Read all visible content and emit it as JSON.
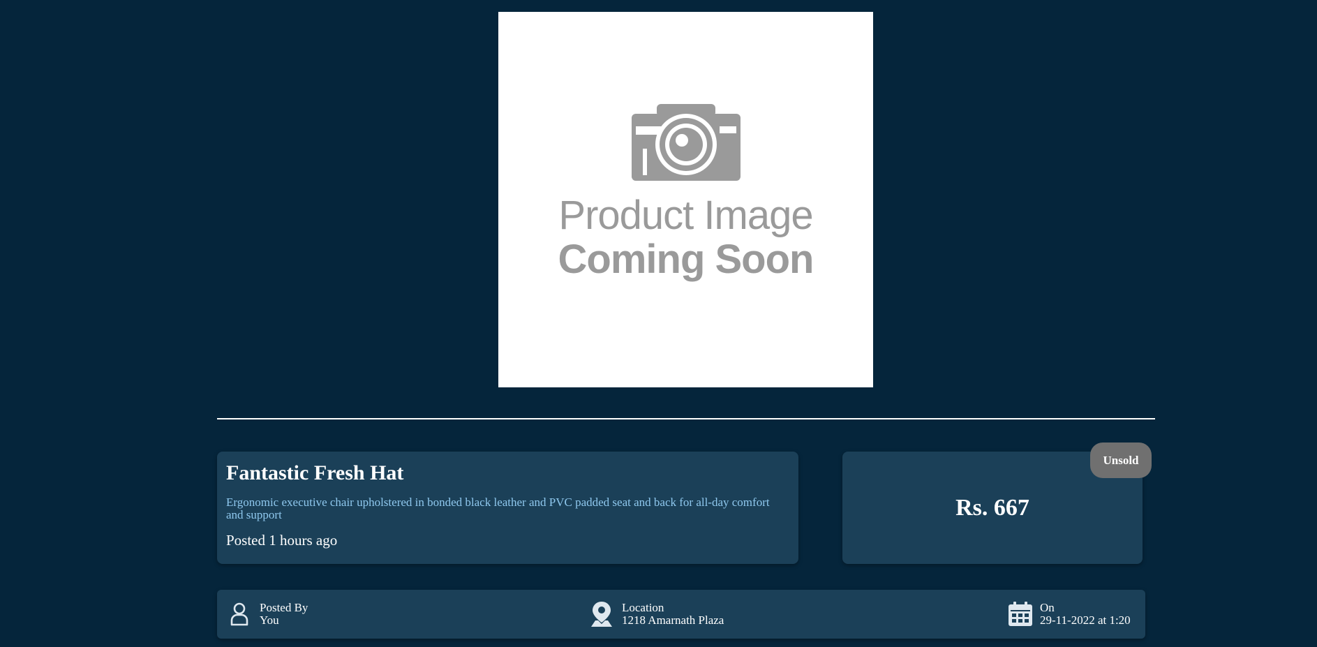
{
  "product": {
    "image_placeholder": {
      "line1": "Product Image",
      "line2": "Coming Soon",
      "icon": "camera-icon"
    },
    "title": "Fantastic Fresh Hat",
    "description": "Ergonomic executive chair upholstered in bonded black leather and PVC padded seat and back for all-day comfort and support",
    "posted_ago": "Posted 1 hours ago",
    "price": "Rs. 667",
    "status": "Unsold"
  },
  "meta": {
    "posted_by": {
      "label": "Posted By",
      "value": "You",
      "icon": "user-icon"
    },
    "location": {
      "label": "Location",
      "value": "1218 Amarnath Plaza",
      "icon": "map-pin-icon"
    },
    "date": {
      "label": "On",
      "value": "29-11-2022 at 1:20",
      "icon": "calendar-icon"
    }
  },
  "colors": {
    "background": "#05253b",
    "card": "#1b4058",
    "description_text": "#8fc8ee",
    "badge": "#707070"
  }
}
